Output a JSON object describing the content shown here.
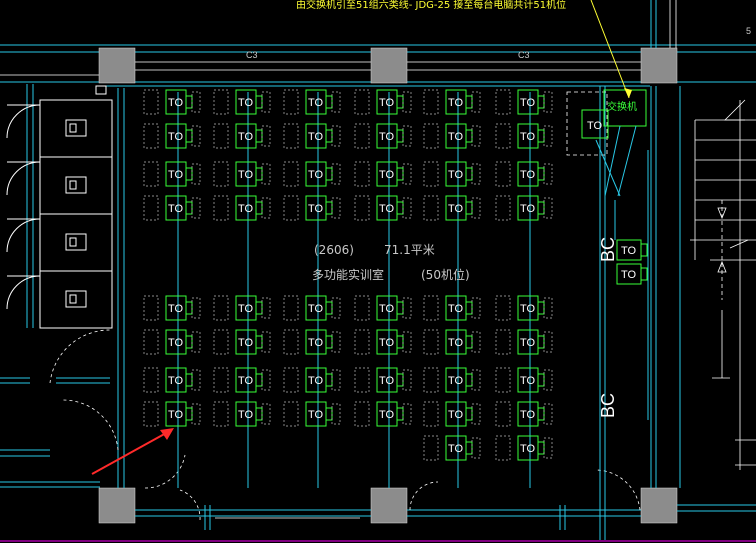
{
  "drawing": {
    "top_note": "由交换机引至51组六类线- JDG-25 接至每台电脑共计51机位",
    "switch_label": "交换机",
    "grid_c3_left": "C3",
    "grid_c3_right": "C3",
    "edge_number": "5",
    "room_code": "(2606)",
    "room_area": "71.1平米",
    "room_name": "多功能实训室",
    "seat_count": "(50机位)",
    "outlet_label": "TO",
    "bc_upper": "BC",
    "bc_lower": "BC"
  },
  "colors": {
    "background": "#000000",
    "green_outlet": "#39ff39",
    "cyan_wall": "#29c8e6",
    "white_line": "#ffffff",
    "gray_column": "#8c8c8c",
    "yellow_text": "#ffff33",
    "red_arrow": "#ff2a2a",
    "magenta_border": "#ff00ff"
  }
}
